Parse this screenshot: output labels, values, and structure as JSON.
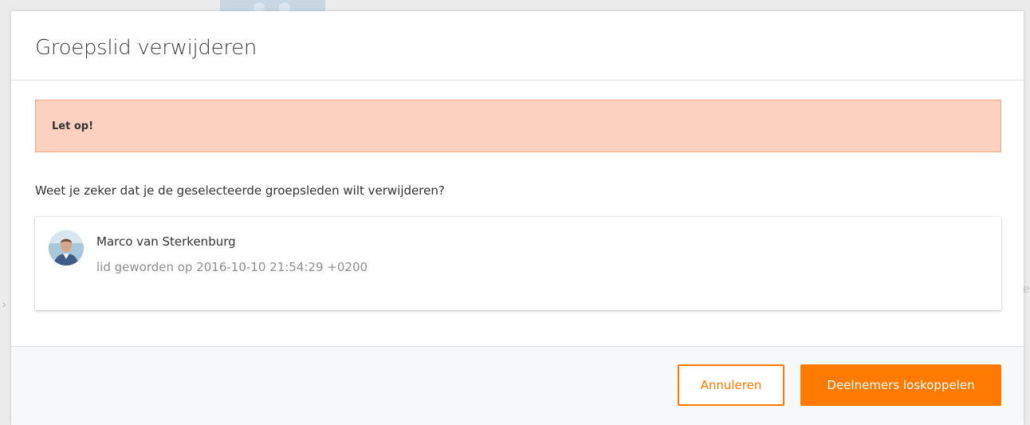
{
  "dialog": {
    "title": "Groepslid verwijderen",
    "alert": {
      "title": "Let op!"
    },
    "confirm_text": "Weet je zeker dat je de geselecteerde groepsleden wilt verwijderen?",
    "members": [
      {
        "name": "Marco van Sterkenburg",
        "meta": "lid geworden op 2016-10-10 21:54:29 +0200"
      }
    ],
    "buttons": {
      "cancel_label": "Annuleren",
      "confirm_label": "Deelnemers loskoppelen"
    }
  },
  "colors": {
    "accent": "#ff7a00",
    "alert_background": "#fcd1c0",
    "alert_border": "#e8a68c",
    "footer_background": "#f7f8fa"
  },
  "icons": {
    "member_avatar": "user-photo",
    "backdrop_left": "chevron-right-icon"
  }
}
